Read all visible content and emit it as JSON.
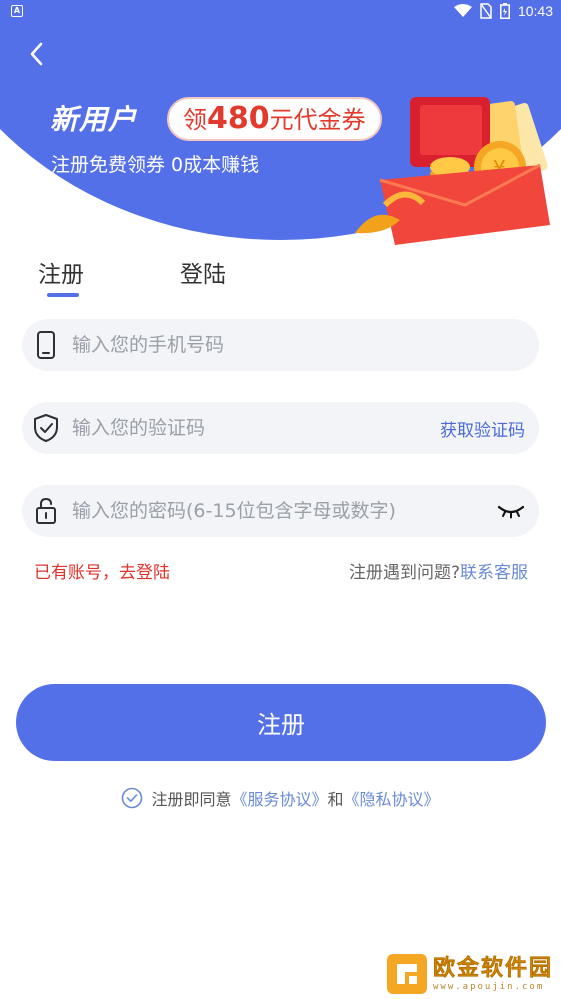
{
  "status_bar": {
    "time": "10:43",
    "icons": [
      "app-notification-icon",
      "wifi-icon",
      "no-sim-icon",
      "battery-icon"
    ]
  },
  "header": {
    "back_icon": "chevron-left-icon",
    "promo_title": "新用户",
    "promo_badge_prefix": "领",
    "promo_badge_amount": "480",
    "promo_badge_suffix": "元代金券",
    "promo_subtitle": "注册免费领券 0成本赚钱"
  },
  "tabs": [
    {
      "label": "注册",
      "active": true
    },
    {
      "label": "登陆",
      "active": false
    }
  ],
  "form": {
    "phone": {
      "placeholder": "输入您的手机号码",
      "value": "",
      "icon": "phone-icon"
    },
    "code": {
      "placeholder": "输入您的验证码",
      "value": "",
      "icon": "shield-check-icon",
      "action_label": "获取验证码"
    },
    "password": {
      "placeholder": "输入您的密码(6-15位包含字母或数字)",
      "value": "",
      "icon": "lock-icon",
      "toggle_icon": "eye-closed-icon"
    }
  },
  "links": {
    "have_account": "已有账号，去登陆",
    "help_text": "注册遇到问题?",
    "contact": "联系客服"
  },
  "submit_label": "注册",
  "agreement": {
    "prefix": "注册即同意",
    "service": "《服务协议》",
    "and": "和",
    "privacy": "《隐私协议》"
  },
  "watermark": {
    "name": "欧金软件园",
    "url": "www.apoujin.com"
  },
  "colors": {
    "primary": "#5470e8",
    "accent_red": "#e0322b",
    "link_blue": "#6a8ad8",
    "field_bg": "#f3f4f7"
  }
}
